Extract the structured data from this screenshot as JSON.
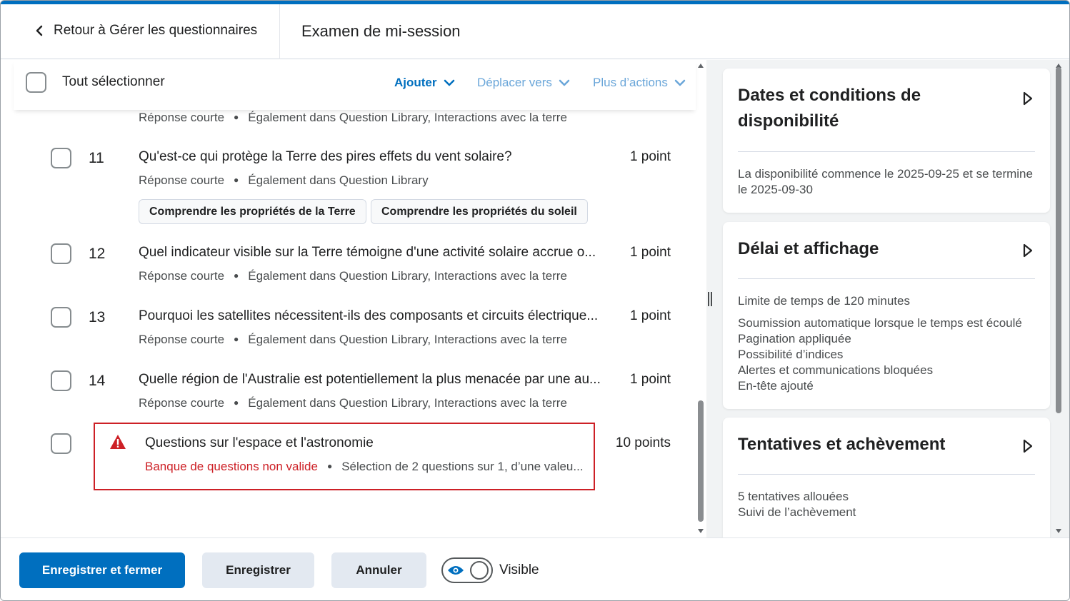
{
  "header": {
    "back_label": "Retour à Gérer les questionnaires",
    "title": "Examen de mi-session"
  },
  "toolbar": {
    "select_all_label": "Tout sélectionner",
    "add_label": "Ajouter",
    "move_label": "Déplacer vers",
    "more_label": "Plus d’actions"
  },
  "partial_row": {
    "type": "Réponse courte",
    "also_in": "Également dans Question Library, Interactions avec la terre"
  },
  "questions": [
    {
      "number": "11",
      "text": "Qu'est-ce qui protège la Terre des pires effets du vent solaire?",
      "points": "1 point",
      "type": "Réponse courte",
      "also_in": "Également dans Question Library",
      "tags": [
        "Comprendre les propriétés de la Terre",
        "Comprendre les propriétés du soleil"
      ]
    },
    {
      "number": "12",
      "text": "Quel indicateur visible sur la Terre témoigne d'une activité solaire accrue o...",
      "points": "1 point",
      "type": "Réponse courte",
      "also_in": "Également dans Question Library, Interactions avec la terre"
    },
    {
      "number": "13",
      "text": "Pourquoi les satellites nécessitent-ils des composants et circuits électrique...",
      "points": "1 point",
      "type": "Réponse courte",
      "also_in": "Également dans Question Library, Interactions avec la terre"
    },
    {
      "number": "14",
      "text": "Quelle région de l'Australie est potentiellement la plus menacée par une au...",
      "points": "1 point",
      "type": "Réponse courte",
      "also_in": "Également dans Question Library, Interactions avec la terre"
    }
  ],
  "question_bank": {
    "title": "Questions sur l'espace et l'astronomie",
    "error": "Banque de questions non valide",
    "detail": "Sélection de 2 questions sur 1, d’une valeu...",
    "points": "10 points",
    "error_color": "#cd2026"
  },
  "side_cards": [
    {
      "title": "Dates et conditions de disponibilité",
      "lines": [
        "La disponibilité commence le 2025-09-25 et se termine le 2025-09-30"
      ]
    },
    {
      "title": "Délai et affichage",
      "lines_first": "Limite de temps de 120 minutes",
      "lines": [
        "Soumission automatique lorsque le temps est écoulé",
        "Pagination appliquée",
        "Possibilité d’indices",
        "Alertes et communications bloquées",
        "En-tête ajouté"
      ]
    },
    {
      "title": "Tentatives et achèvement",
      "lines": [
        "5 tentatives allouées",
        "Suivi de l’achèvement"
      ]
    }
  ],
  "footer": {
    "save_close_label": "Enregistrer et fermer",
    "save_label": "Enregistrer",
    "cancel_label": "Annuler",
    "visible_label": "Visible"
  },
  "colors": {
    "primary": "#006fbf",
    "error": "#cd2026"
  }
}
